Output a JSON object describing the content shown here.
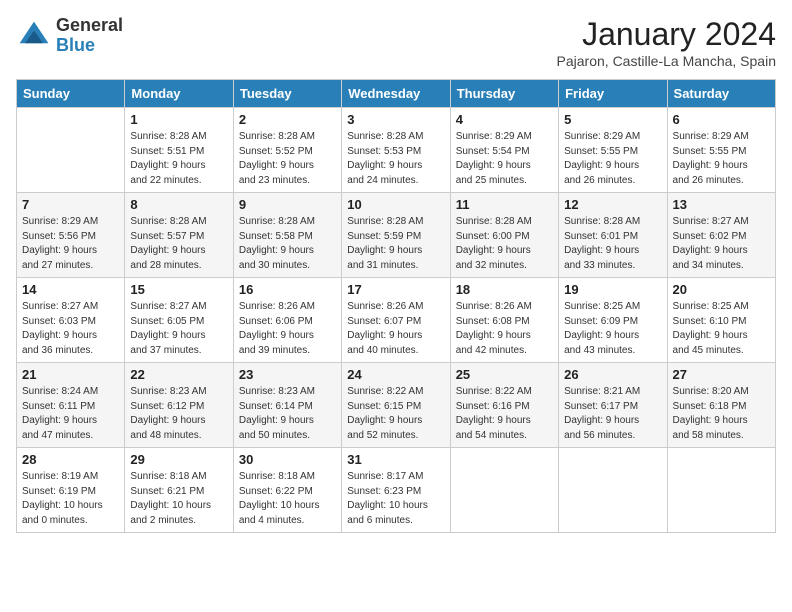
{
  "header": {
    "logo_general": "General",
    "logo_blue": "Blue",
    "month_title": "January 2024",
    "location": "Pajaron, Castille-La Mancha, Spain"
  },
  "days_of_week": [
    "Sunday",
    "Monday",
    "Tuesday",
    "Wednesday",
    "Thursday",
    "Friday",
    "Saturday"
  ],
  "weeks": [
    [
      {
        "day": "",
        "info": ""
      },
      {
        "day": "1",
        "info": "Sunrise: 8:28 AM\nSunset: 5:51 PM\nDaylight: 9 hours\nand 22 minutes."
      },
      {
        "day": "2",
        "info": "Sunrise: 8:28 AM\nSunset: 5:52 PM\nDaylight: 9 hours\nand 23 minutes."
      },
      {
        "day": "3",
        "info": "Sunrise: 8:28 AM\nSunset: 5:53 PM\nDaylight: 9 hours\nand 24 minutes."
      },
      {
        "day": "4",
        "info": "Sunrise: 8:29 AM\nSunset: 5:54 PM\nDaylight: 9 hours\nand 25 minutes."
      },
      {
        "day": "5",
        "info": "Sunrise: 8:29 AM\nSunset: 5:55 PM\nDaylight: 9 hours\nand 26 minutes."
      },
      {
        "day": "6",
        "info": "Sunrise: 8:29 AM\nSunset: 5:55 PM\nDaylight: 9 hours\nand 26 minutes."
      }
    ],
    [
      {
        "day": "7",
        "info": "Sunrise: 8:29 AM\nSunset: 5:56 PM\nDaylight: 9 hours\nand 27 minutes."
      },
      {
        "day": "8",
        "info": "Sunrise: 8:28 AM\nSunset: 5:57 PM\nDaylight: 9 hours\nand 28 minutes."
      },
      {
        "day": "9",
        "info": "Sunrise: 8:28 AM\nSunset: 5:58 PM\nDaylight: 9 hours\nand 30 minutes."
      },
      {
        "day": "10",
        "info": "Sunrise: 8:28 AM\nSunset: 5:59 PM\nDaylight: 9 hours\nand 31 minutes."
      },
      {
        "day": "11",
        "info": "Sunrise: 8:28 AM\nSunset: 6:00 PM\nDaylight: 9 hours\nand 32 minutes."
      },
      {
        "day": "12",
        "info": "Sunrise: 8:28 AM\nSunset: 6:01 PM\nDaylight: 9 hours\nand 33 minutes."
      },
      {
        "day": "13",
        "info": "Sunrise: 8:27 AM\nSunset: 6:02 PM\nDaylight: 9 hours\nand 34 minutes."
      }
    ],
    [
      {
        "day": "14",
        "info": "Sunrise: 8:27 AM\nSunset: 6:03 PM\nDaylight: 9 hours\nand 36 minutes."
      },
      {
        "day": "15",
        "info": "Sunrise: 8:27 AM\nSunset: 6:05 PM\nDaylight: 9 hours\nand 37 minutes."
      },
      {
        "day": "16",
        "info": "Sunrise: 8:26 AM\nSunset: 6:06 PM\nDaylight: 9 hours\nand 39 minutes."
      },
      {
        "day": "17",
        "info": "Sunrise: 8:26 AM\nSunset: 6:07 PM\nDaylight: 9 hours\nand 40 minutes."
      },
      {
        "day": "18",
        "info": "Sunrise: 8:26 AM\nSunset: 6:08 PM\nDaylight: 9 hours\nand 42 minutes."
      },
      {
        "day": "19",
        "info": "Sunrise: 8:25 AM\nSunset: 6:09 PM\nDaylight: 9 hours\nand 43 minutes."
      },
      {
        "day": "20",
        "info": "Sunrise: 8:25 AM\nSunset: 6:10 PM\nDaylight: 9 hours\nand 45 minutes."
      }
    ],
    [
      {
        "day": "21",
        "info": "Sunrise: 8:24 AM\nSunset: 6:11 PM\nDaylight: 9 hours\nand 47 minutes."
      },
      {
        "day": "22",
        "info": "Sunrise: 8:23 AM\nSunset: 6:12 PM\nDaylight: 9 hours\nand 48 minutes."
      },
      {
        "day": "23",
        "info": "Sunrise: 8:23 AM\nSunset: 6:14 PM\nDaylight: 9 hours\nand 50 minutes."
      },
      {
        "day": "24",
        "info": "Sunrise: 8:22 AM\nSunset: 6:15 PM\nDaylight: 9 hours\nand 52 minutes."
      },
      {
        "day": "25",
        "info": "Sunrise: 8:22 AM\nSunset: 6:16 PM\nDaylight: 9 hours\nand 54 minutes."
      },
      {
        "day": "26",
        "info": "Sunrise: 8:21 AM\nSunset: 6:17 PM\nDaylight: 9 hours\nand 56 minutes."
      },
      {
        "day": "27",
        "info": "Sunrise: 8:20 AM\nSunset: 6:18 PM\nDaylight: 9 hours\nand 58 minutes."
      }
    ],
    [
      {
        "day": "28",
        "info": "Sunrise: 8:19 AM\nSunset: 6:19 PM\nDaylight: 10 hours\nand 0 minutes."
      },
      {
        "day": "29",
        "info": "Sunrise: 8:18 AM\nSunset: 6:21 PM\nDaylight: 10 hours\nand 2 minutes."
      },
      {
        "day": "30",
        "info": "Sunrise: 8:18 AM\nSunset: 6:22 PM\nDaylight: 10 hours\nand 4 minutes."
      },
      {
        "day": "31",
        "info": "Sunrise: 8:17 AM\nSunset: 6:23 PM\nDaylight: 10 hours\nand 6 minutes."
      },
      {
        "day": "",
        "info": ""
      },
      {
        "day": "",
        "info": ""
      },
      {
        "day": "",
        "info": ""
      }
    ]
  ]
}
